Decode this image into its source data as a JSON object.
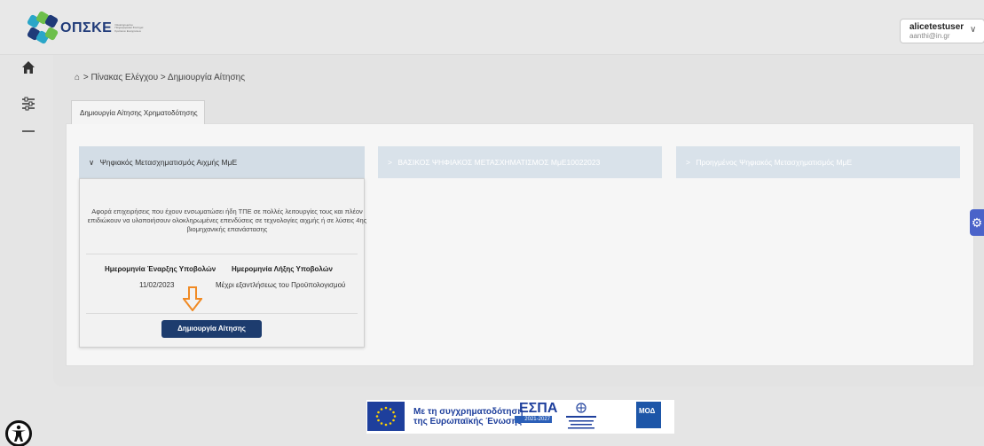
{
  "header": {
    "logo_text": "ΟΠΣΚΕ",
    "logo_subtitle": "Ολοκληρωμένο Πληροφοριακό Σύστημα Κρατικών Ενισχύσεων",
    "user": {
      "name": "alicetestuser",
      "email": "aanthi@in.gr"
    }
  },
  "sidebar": {
    "items": [
      {
        "icon": "home-icon"
      },
      {
        "icon": "sliders-icon"
      },
      {
        "icon": "minus-icon"
      }
    ]
  },
  "breadcrumb": {
    "home_icon": "⌂",
    "path": "> Πίνακας Ελέγχου > Δημιουργία Αίτησης"
  },
  "tab": {
    "label": "Δημιουργία Αίτησης Χρηματοδότησης"
  },
  "accordions": [
    {
      "label": "Ψηφιακός Μετασχηματισμός Αιχμής ΜμΕ",
      "chevron": "∨",
      "expanded": true
    },
    {
      "label": "ΒΑΣΙΚΟΣ ΨΗΦΙΑΚΟΣ ΜΕΤΑΣΧΗΜΑΤΙΣΜΟΣ ΜμΕ10022023",
      "chevron": ">",
      "expanded": false
    },
    {
      "label": "Προηγμένος Ψηφιακός Μετασχηματισμός ΜμΕ",
      "chevron": ">",
      "expanded": false
    }
  ],
  "card": {
    "description": "Αφορά επιχειρήσεις που έχουν ενσωματώσει ήδη ΤΠΕ σε πολλές λειτουργίες τους και πλέον επιδιώκουν να υλοποιήσουν ολοκληρωμένες επενδύσεις σε τεχνολογίες αιχμής ή σε λύσεις 4ης βιομηχανικής επανάστασης",
    "start_label": "Ημερομηνία Έναρξης Υποβολών",
    "start_value": "11/02/2023",
    "end_label": "Ημερομηνία Λήξης Υποβολών",
    "end_value": "Μέχρι εξαντλήσεως του Προϋπολογισμού",
    "button_label": "Δημιουργία Αίτησης"
  },
  "footer": {
    "eu_text_line1": "Με τη συγχρηματοδότηση",
    "eu_text_line2": "της Ευρωπαϊκής Ένωσης",
    "espa": "ΕΣΠΑ",
    "espa_years": "2021-2027",
    "moda": "ΜΟΔ"
  },
  "colors": {
    "accent": "#1d3c6e",
    "arrow": "#f08a24",
    "gear_tab": "#4a63c9",
    "accordion": "#d9e2ea"
  }
}
